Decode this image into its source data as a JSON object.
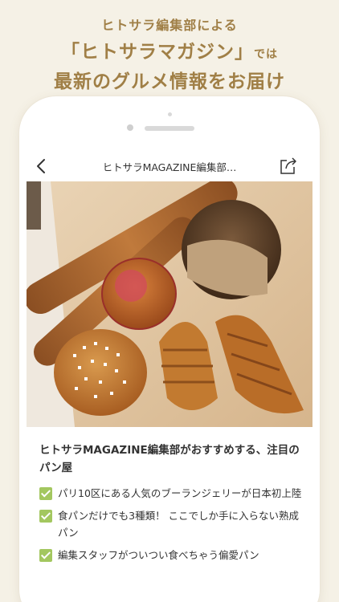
{
  "promo": {
    "line1": "ヒトサラ編集部による",
    "line2_main": "「ヒトサラマガジン」",
    "line2_suffix": "では",
    "line3": "最新のグルメ情報をお届け"
  },
  "navbar": {
    "back_icon": "chevron-left-icon",
    "title": "ヒトサラMAGAZINE編集部…",
    "share_icon": "share-icon"
  },
  "hero_image": {
    "alt": "baguettes, croissants and sweet breads on a wooden board"
  },
  "article": {
    "headline": "ヒトサラMAGAZINE編集部がおすすめする、注目のパン屋",
    "points": [
      "パリ10区にある人気のブーランジェリーが日本初上陸",
      "食パンだけでも3種類！ ここでしか手に入らない熟成パン",
      "編集スタッフがついつい食べちゃう偏愛パン"
    ]
  },
  "colors": {
    "background": "#f5f1e6",
    "promo_text": "#a07f46",
    "check": "#a3c75f"
  }
}
